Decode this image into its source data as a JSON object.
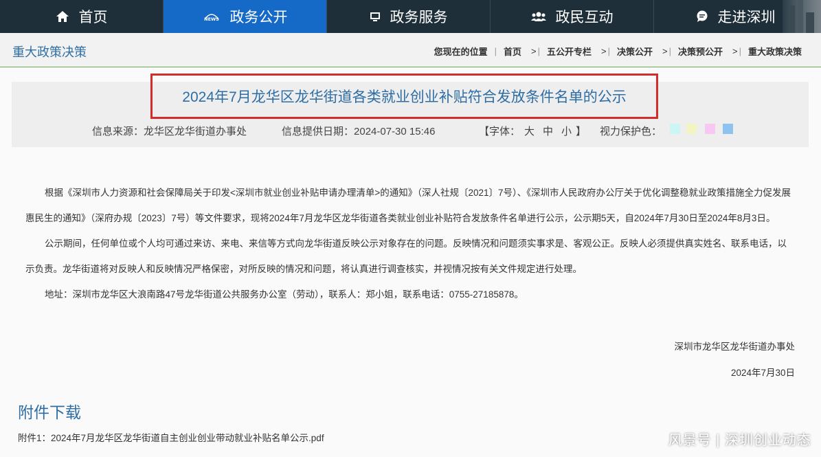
{
  "nav": {
    "items": [
      {
        "label": "首页",
        "icon": "home-icon"
      },
      {
        "label": "政务公开",
        "icon": "news-icon",
        "active": true
      },
      {
        "label": "政务服务",
        "icon": "monitor-icon"
      },
      {
        "label": "政民互动",
        "icon": "people-icon"
      },
      {
        "label": "走进深圳",
        "icon": "chat-icon"
      }
    ],
    "news_badge": "NEWS"
  },
  "subheader": {
    "section_title": "重大政策决策",
    "breadcrumb_prefix": "您现在的位置",
    "crumbs": [
      "首页",
      "五公开专栏",
      "决策公开",
      "决策预公开",
      "重大政策决策"
    ],
    "separator": ">"
  },
  "article": {
    "title": "2024年7月龙华区龙华街道各类就业创业补贴符合发放条件名单的公示",
    "source_label": "信息来源：",
    "source": "龙华区龙华街道办事处",
    "date_label": "信息提供日期：",
    "date": "2024-07-30 15:46",
    "font_label_open": "【字体：",
    "font_sizes": [
      "大",
      "中",
      "小"
    ],
    "font_label_close": "】",
    "eye_care_label": "视力保护色：",
    "eye_care_colors": [
      "#ccf5f5",
      "#f3f3c4",
      "#f7c9f2",
      "#8ec2ef"
    ],
    "paragraphs": [
      "根据《深圳市人力资源和社会保障局关于印发<深圳市就业创业补贴申请办理清单>的通知》（深人社规〔2021〕7号）、《深圳市人民政府办公厅关于优化调整稳就业政策措施全力促发展惠民生的通知》（深府办规〔2023〕7号）等文件要求，现将2024年7月龙华区龙华街道各类就业创业补贴符合发放条件名单进行公示，公示期5天，自2024年7月30日至2024年8月3日。",
      "公示期间，任何单位或个人均可通过来访、来电、来信等方式向龙华街道反映公示对象存在的问题。反映情况和问题须实事求是、客观公正。反映人必须提供真实姓名、联系电话，以示负责。龙华街道将对反映人和反映情况严格保密，对所反映的情况和问题，将认真进行调查核实，并视情况按有关文件规定进行处理。",
      "地址：深圳市龙华区大浪南路47号龙华街道公共服务办公室（劳动），联系人：郑小姐，联系电话：0755-27185878。"
    ],
    "signature": "深圳市龙华区龙华街道办事处",
    "sign_date": "2024年7月30日"
  },
  "attachments": {
    "heading": "附件下载",
    "items": [
      "附件1：2024年7月龙华区龙华街道自主创业创业带动就业补贴名单公示.pdf"
    ]
  },
  "watermark": "风景号 | 深圳创业动态"
}
